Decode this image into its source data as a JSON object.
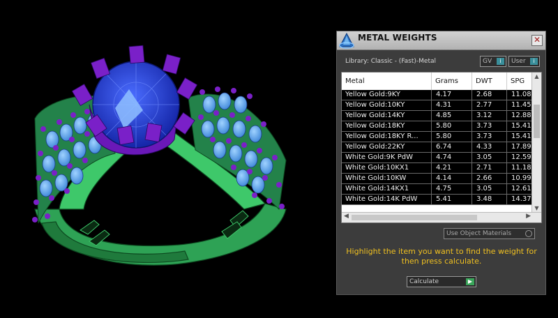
{
  "panel": {
    "title": "METAL WEIGHTS",
    "close_icon": "close-icon",
    "library_label": "Library: Classic - (Fast)-Metal",
    "toggles": [
      {
        "label": "GV",
        "button": "i"
      },
      {
        "label": "User",
        "button": "i"
      }
    ],
    "table": {
      "headers": [
        "Metal",
        "Grams",
        "DWT",
        "SPG"
      ],
      "rows": [
        [
          "Yellow Gold:9KY",
          "4.17",
          "2.68",
          "11.08"
        ],
        [
          "Yellow Gold:10KY",
          "4.31",
          "2.77",
          "11.45"
        ],
        [
          "Yellow Gold:14KY",
          "4.85",
          "3.12",
          "12.88"
        ],
        [
          "Yellow Gold:18KY",
          "5.80",
          "3.73",
          "15.41"
        ],
        [
          "Yellow Gold:18KY R...",
          "5.80",
          "3.73",
          "15.41"
        ],
        [
          "Yellow Gold:22KY",
          "6.74",
          "4.33",
          "17.89"
        ],
        [
          "White Gold:9K PdW",
          "4.74",
          "3.05",
          "12.59"
        ],
        [
          "White Gold:10KX1",
          "4.21",
          "2.71",
          "11.18"
        ],
        [
          "White Gold:10KW",
          "4.14",
          "2.66",
          "10.99"
        ],
        [
          "White Gold:14KX1",
          "4.75",
          "3.05",
          "12.61"
        ],
        [
          "White Gold:14K PdW",
          "5.41",
          "3.48",
          "14.37"
        ]
      ]
    },
    "use_object_materials": "Use Object Materials",
    "instruction": "Highlight the item you want to find the weight for then press calculate.",
    "calculate_label": "Calculate",
    "calculate_icon": "play-arrow-icon",
    "colors": {
      "panel_bg": "#3c3c3c",
      "instruction": "#f0c020",
      "toggle_accent": "#3a8f9b",
      "calc_accent": "#3aa55a"
    }
  },
  "viewport": {
    "subject": "3D ring model",
    "colors": {
      "band": "#3ec86a",
      "accent_stones": "#7a20c8",
      "center_stone": "#1e3fd8",
      "side_stones": "#5ab0f0"
    }
  }
}
